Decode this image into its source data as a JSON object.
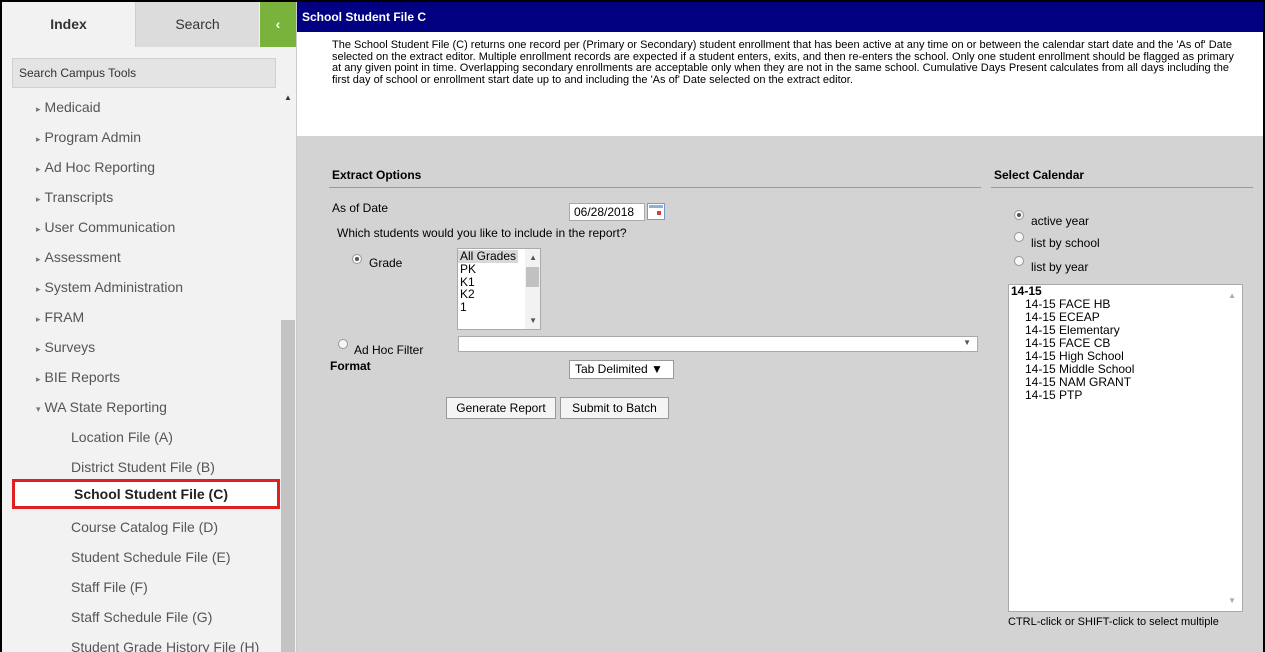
{
  "sidebar": {
    "tabs": {
      "index": "Index",
      "search": "Search",
      "collapse": "‹"
    },
    "search_placeholder": "Search Campus Tools",
    "items": [
      {
        "label": "Medicaid"
      },
      {
        "label": "Program Admin"
      },
      {
        "label": "Ad Hoc Reporting"
      },
      {
        "label": "Transcripts"
      },
      {
        "label": "User Communication"
      },
      {
        "label": "Assessment"
      },
      {
        "label": "System Administration"
      },
      {
        "label": "FRAM"
      },
      {
        "label": "Surveys"
      },
      {
        "label": "BIE Reports"
      },
      {
        "label": "WA State Reporting"
      }
    ],
    "collapsed_arrow": "▸",
    "expanded_arrow": "▾",
    "children": [
      {
        "label": "Location File (A)"
      },
      {
        "label": "District Student File (B)"
      },
      {
        "label": "School Student File (C)"
      },
      {
        "label": "Course Catalog File (D)"
      },
      {
        "label": "Student Schedule File (E)"
      },
      {
        "label": "Staff File (F)"
      },
      {
        "label": "Staff Schedule File (G)"
      },
      {
        "label": "Student Grade History File (H)"
      }
    ]
  },
  "main": {
    "title": "School Student File C",
    "description": "The School Student File (C) returns one record per (Primary or Secondary) student enrollment that has been active at any time on or between the calendar start date and the 'As of' Date selected on the extract editor. Multiple enrollment records are expected if a student enters, exits, and then re-enters the school. Only one student enrollment should be flagged as primary at any given point in time. Overlapping secondary enrollments are acceptable only when they are not in the same school. Cumulative Days Present calculates from all days including the first day of school or enrollment start date up to and including the 'As of' Date selected on the extract editor.",
    "extract_options": {
      "title": "Extract Options",
      "as_of_label": "As of Date",
      "as_of_value": "06/28/2018",
      "question": "Which students would you like to include in the report?",
      "grade_label": "Grade",
      "grade_options": [
        "All Grades",
        "PK",
        "K1",
        "K2",
        "1"
      ],
      "adhoc_label": "Ad Hoc Filter",
      "format_label": "Format",
      "format_value": "Tab Delimited ▼",
      "generate_button": "Generate Report",
      "batch_button": "Submit to Batch"
    },
    "calendar": {
      "title": "Select Calendar",
      "radios": [
        "active year",
        "list by school",
        "list by year"
      ],
      "selected_radio": "active year",
      "year": "14-15",
      "items": [
        "14-15 FACE HB",
        "14-15 ECEAP",
        "14-15 Elementary",
        "14-15 FACE CB",
        "14-15 High School",
        "14-15 Middle School",
        "14-15 NAM GRANT",
        "14-15 PTP"
      ],
      "hint": "CTRL-click or SHIFT-click to select multiple"
    }
  }
}
